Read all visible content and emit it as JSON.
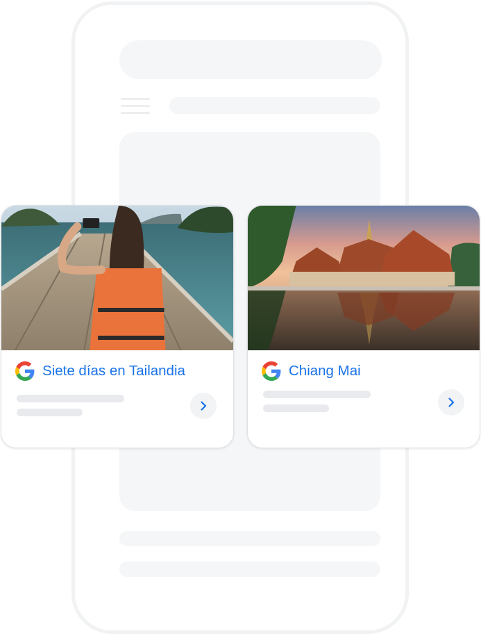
{
  "cards": [
    {
      "title": "Siete días en Tailandia",
      "image_icon": "woman-on-longtail-boat-photo",
      "action_icon": "chevron-right-icon"
    },
    {
      "title": "Chiang Mai",
      "image_icon": "thai-temple-reflection-photo",
      "action_icon": "chevron-right-icon"
    }
  ],
  "colors": {
    "title": "#1a73e8",
    "placeholder_line": "#e8eaed",
    "phone_outline": "#f1f2f3",
    "google_blue": "#4285F4",
    "google_red": "#EA4335",
    "google_yellow": "#FBBC05",
    "google_green": "#34A853"
  }
}
